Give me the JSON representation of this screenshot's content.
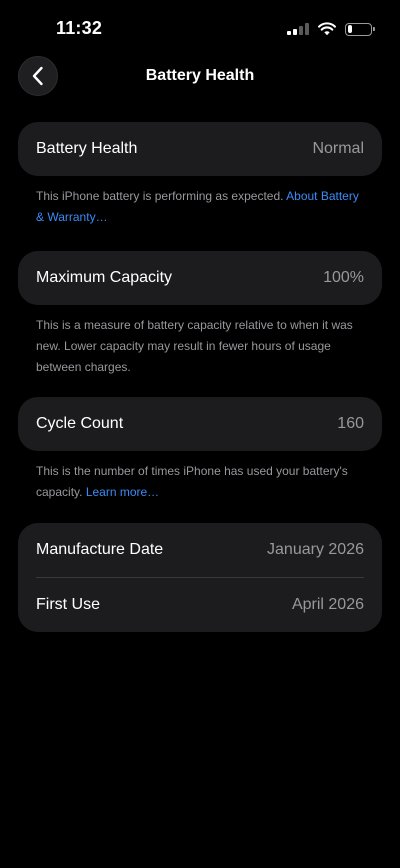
{
  "status_bar": {
    "time": "11:32",
    "battery_level": 0.2
  },
  "nav": {
    "title": "Battery Health",
    "back_icon": "chevron-left-icon"
  },
  "sections": {
    "health": {
      "label": "Battery Health",
      "value": "Normal",
      "note": "This iPhone battery is performing as expected. ",
      "link": "About Battery & Warranty…"
    },
    "capacity": {
      "label": "Maximum Capacity",
      "value": "100%",
      "note": "This is a measure of battery capacity relative to when it was new. Lower capacity may result in fewer hours of usage between charges."
    },
    "cycles": {
      "label": "Cycle Count",
      "value": "160",
      "note": "This is the number of times iPhone has used your battery's capacity. ",
      "link": "Learn more…"
    },
    "dates": {
      "manufacture_label": "Manufacture Date",
      "manufacture_value": "January 2026",
      "first_use_label": "First Use",
      "first_use_value": "April 2026"
    }
  },
  "colors": {
    "background": "#000000",
    "card": "#1c1c1e",
    "secondary_text": "#98989d",
    "link": "#3b8bf6"
  }
}
